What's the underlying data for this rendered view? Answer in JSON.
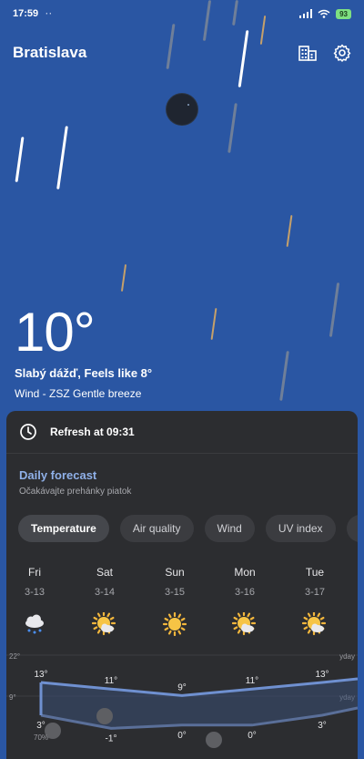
{
  "status": {
    "time": "17:59",
    "dots": "··",
    "battery": "93"
  },
  "header": {
    "city": "Bratislava"
  },
  "current": {
    "temperature": "10°",
    "description": "Slabý dážď, Feels like 8°",
    "wind": "Wind - ZSZ Gentle breeze"
  },
  "refresh": {
    "label": "Refresh at 09:31"
  },
  "daily": {
    "title": "Daily forecast",
    "subtitle": "Očakávajte prehánky piatok",
    "tabs": [
      "Temperature",
      "Air quality",
      "Wind",
      "UV index"
    ],
    "active_tab": "Temperature",
    "days": [
      {
        "name": "Fri",
        "date": "3-13",
        "icon": "rain-cloud-icon",
        "high": "13°",
        "low": "3°"
      },
      {
        "name": "Sat",
        "date": "3-14",
        "icon": "partly-sunny-icon",
        "high": "11°",
        "low": "-1°"
      },
      {
        "name": "Sun",
        "date": "3-15",
        "icon": "sun-icon",
        "high": "9°",
        "low": "0°"
      },
      {
        "name": "Mon",
        "date": "3-16",
        "icon": "partly-sunny-icon",
        "high": "11°",
        "low": "0°"
      },
      {
        "name": "Tue",
        "date": "3-17",
        "icon": "partly-sunny-icon",
        "high": "13°",
        "low": "3°"
      }
    ],
    "chart": {
      "y_top_label": "22°",
      "y_mid_label": "9°",
      "yday_label": "yday",
      "precip_label": "70%",
      "highs": [
        13,
        11,
        9,
        11,
        13
      ],
      "lows": [
        3,
        -1,
        0,
        0,
        3
      ],
      "colors": {
        "high_line": "#6f90d0",
        "low_line": "#5a6f99",
        "fill": "#3a4e75"
      }
    }
  }
}
